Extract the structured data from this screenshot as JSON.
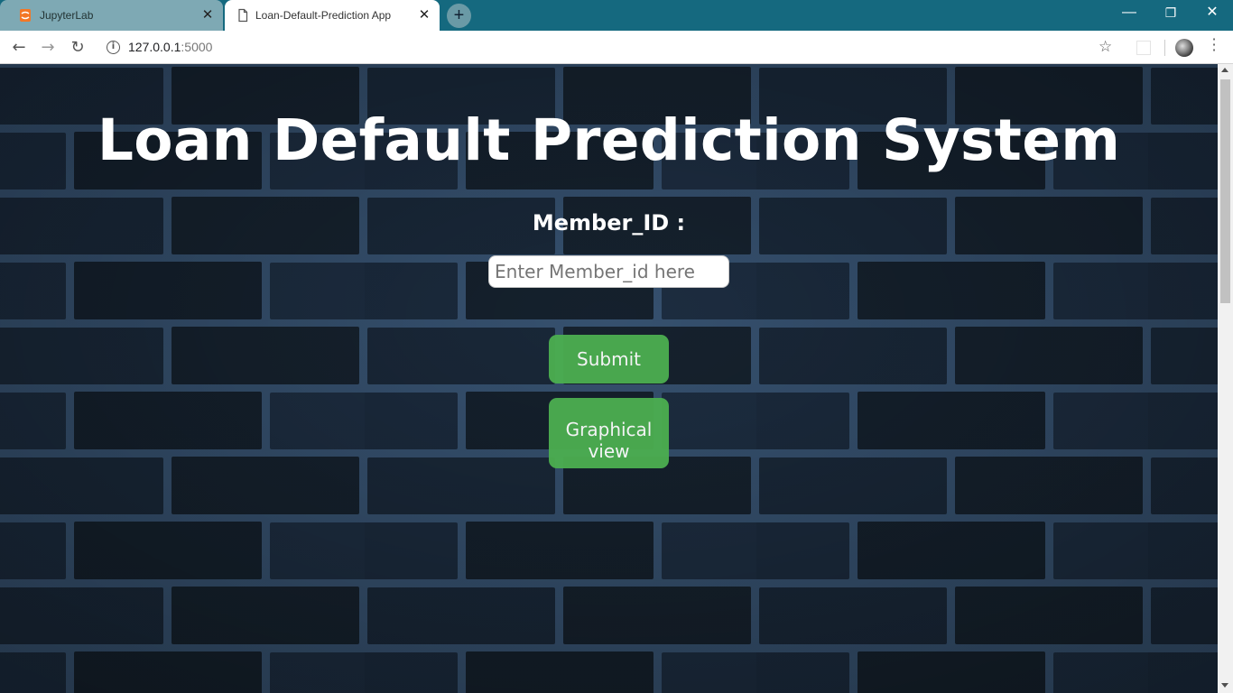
{
  "browser": {
    "tabs": [
      {
        "title": "JupyterLab",
        "active": false
      },
      {
        "title": "Loan-Default-Prediction App",
        "active": true
      }
    ],
    "new_tab_symbol": "+",
    "window_controls": {
      "minimize": "—",
      "restore": "❐",
      "close": "✕"
    },
    "nav": {
      "back": "←",
      "forward": "→",
      "reload": "↻"
    },
    "url_host": "127.0.0.1",
    "url_port": ":5000",
    "bookmark_icon": "star-icon",
    "menu_icon": "three-dots-icon"
  },
  "page": {
    "title": "Loan Default Prediction System",
    "member_label": "Member_ID :",
    "member_input_placeholder": "Enter Member_id here",
    "member_input_value": "",
    "submit_label": "Submit",
    "graph_label_line1": "Graphical",
    "graph_label_line2": "view"
  },
  "colors": {
    "tabstrip": "#15697f",
    "button": "#4caf50",
    "background": "#0c1621",
    "brick": "#1e2e42",
    "mortar": "#3c5a7e"
  }
}
